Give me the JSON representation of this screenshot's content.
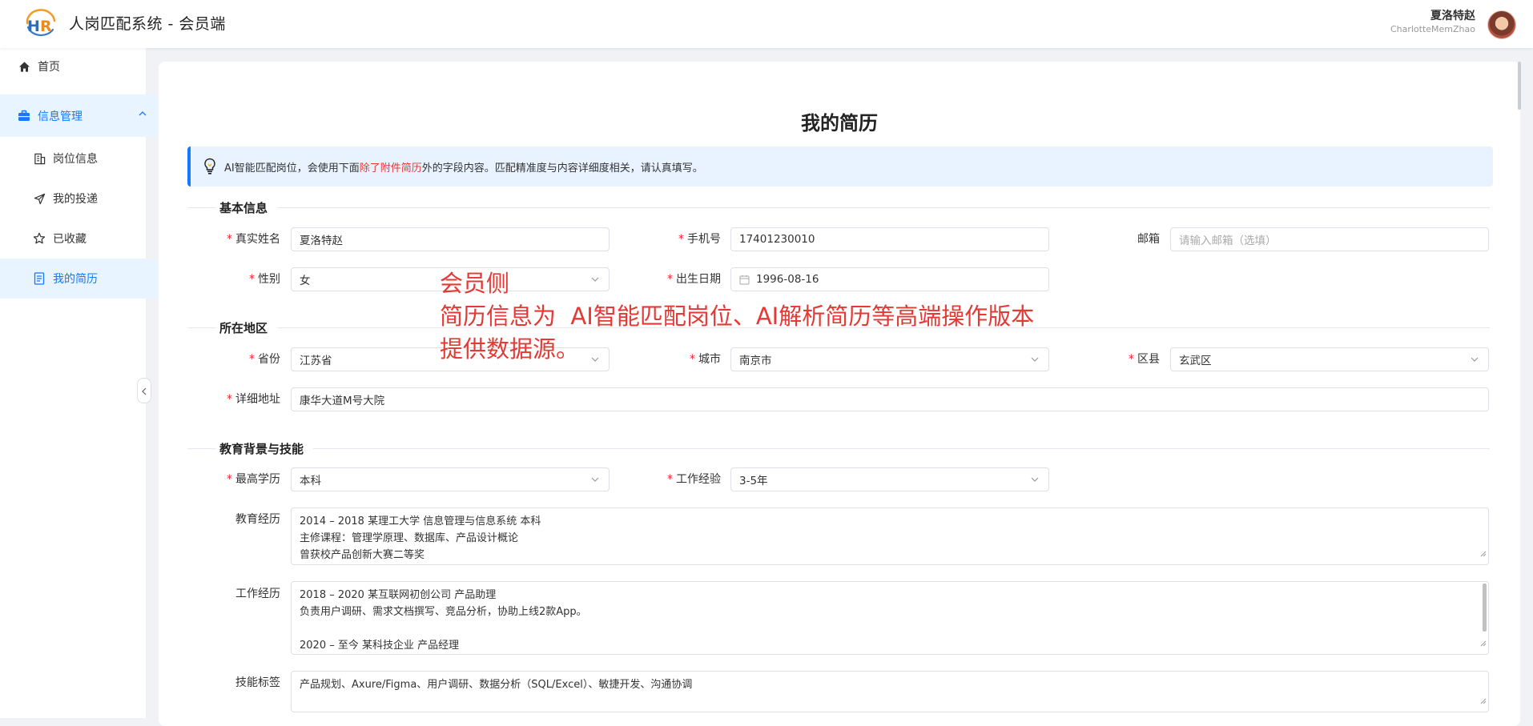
{
  "header": {
    "title": "人岗匹配系统 - 会员端",
    "user_name": "夏洛特赵",
    "user_id": "CharlotteMemZhao"
  },
  "sidebar": {
    "home": "首页",
    "group": "信息管理",
    "items": [
      "岗位信息",
      "我的投递",
      "已收藏",
      "我的简历"
    ],
    "active": "我的简历"
  },
  "page": {
    "title": "我的简历",
    "tip_prefix": "AI智能匹配岗位，会使用下面",
    "tip_highlight": "除了附件简历",
    "tip_suffix": "外的字段内容。匹配精准度与内容详细度相关，请认真填写。"
  },
  "sections": {
    "basic": "基本信息",
    "region": "所在地区",
    "education": "教育背景与技能"
  },
  "form": {
    "name_label": "真实姓名",
    "name_value": "夏洛特赵",
    "phone_label": "手机号",
    "phone_value": "17401230010",
    "email_label": "邮箱",
    "email_placeholder": "请输入邮箱（选填）",
    "gender_label": "性别",
    "gender_value": "女",
    "birth_label": "出生日期",
    "birth_value": "1996-08-16",
    "province_label": "省份",
    "province_value": "江苏省",
    "city_label": "城市",
    "city_value": "南京市",
    "district_label": "区县",
    "district_value": "玄武区",
    "address_label": "详细地址",
    "address_value": "康华大道M号大院",
    "degree_label": "最高学历",
    "degree_value": "本科",
    "experience_label": "工作经验",
    "experience_value": "3-5年",
    "edu_label": "教育经历",
    "edu_lines": [
      "2014 – 2018 某理工大学 信息管理与信息系统 本科",
      "主修课程：管理学原理、数据库、产品设计概论",
      "曾获校产品创新大赛二等奖"
    ],
    "work_label": "工作经历",
    "work_lines": [
      "2018 – 2020 某互联网初创公司 产品助理",
      "负责用户调研、需求文档撰写、竞品分析，协助上线2款App。",
      "",
      "2020 – 至今 某科技企业 产品经理"
    ],
    "skills_label": "技能标签",
    "skills_value": "产品规划、Axure/Figma、用户调研、数据分析（SQL/Excel）、敏捷开发、沟通协调"
  },
  "annotation": {
    "line1": "会员侧",
    "line2": "简历信息为  AI智能匹配岗位、AI解析简历等高端操作版本",
    "line3": "提供数据源。"
  },
  "colors": {
    "primary": "#1677ff",
    "required": "#f5222d",
    "annotation": "#e53935"
  }
}
